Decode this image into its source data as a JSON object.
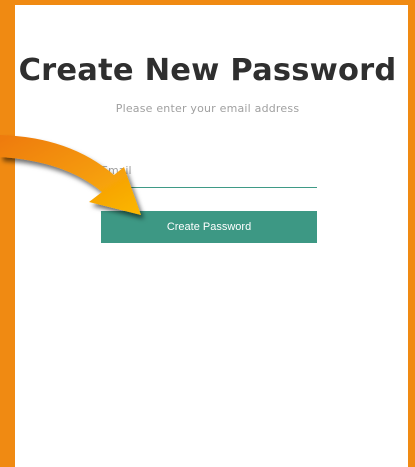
{
  "page": {
    "background_color": "#f08a12",
    "panel_color": "#ffffff"
  },
  "header": {
    "title": "Create New Password",
    "subtitle": "Please enter your email address"
  },
  "form": {
    "email_placeholder": "Email",
    "email_value": "",
    "submit_label": "Create Password",
    "accent_color": "#3d9884"
  },
  "overlay": {
    "arrow_icon": "curved-arrow-icon",
    "arrow_color": "#f7a700"
  }
}
